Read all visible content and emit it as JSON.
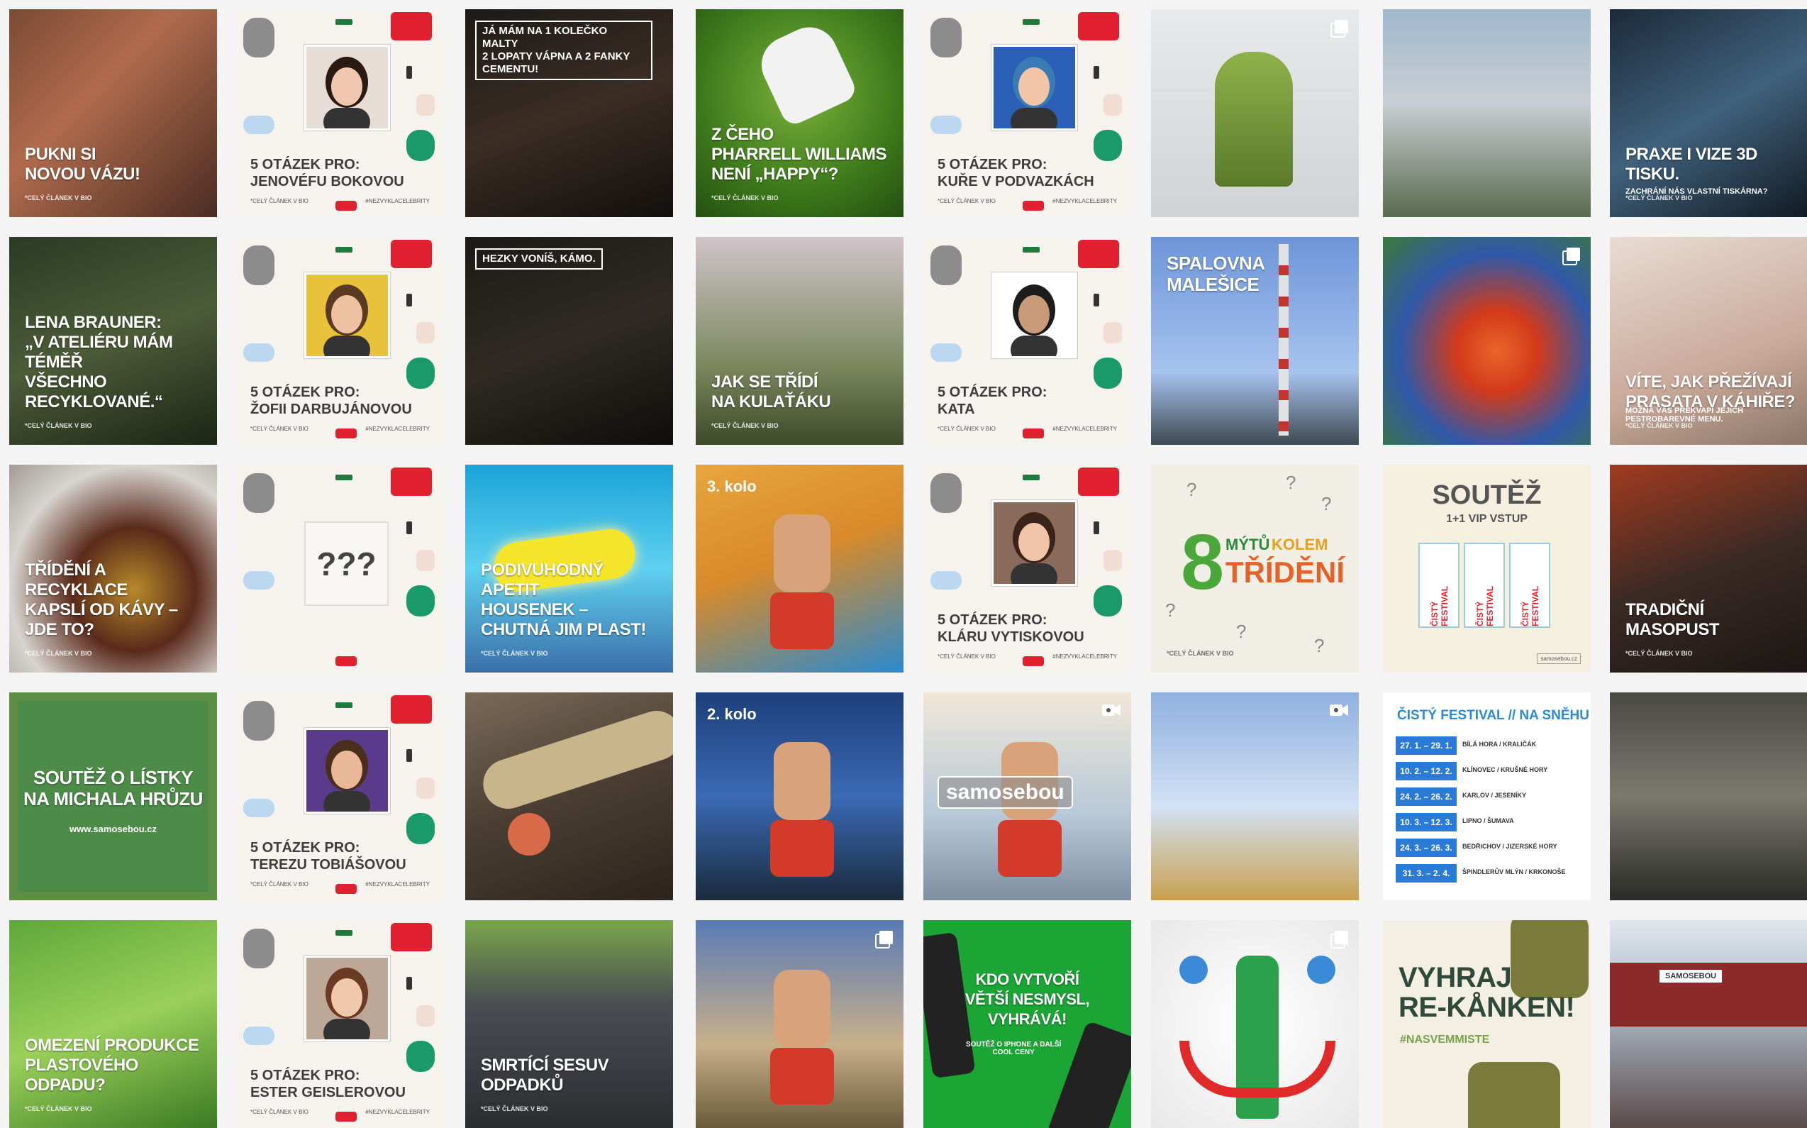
{
  "grid": {
    "tiles": [
      {
        "caption": "Pukni si\nnovou vázu!",
        "sub": "*celý článek v bio"
      },
      {
        "qtitle": "5 otázek pro:\nJenovéfu Bokovou",
        "qsub": "*celý článek v bio",
        "qtag": "#nezvyklacelebrity"
      },
      {
        "badge": "Já mám na 1 kolečko malty\n2 lopaty vápna a 2 fanky cementu!"
      },
      {
        "caption": "Z čeho\nPharrell Williams\nnení „happy“?",
        "sub": "*celý článek v bio"
      },
      {
        "qtitle": "5 otázek pro:\nKuře v podvazkách",
        "qsub": "*celý článek v bio",
        "qtag": "#nezvyklacelebrity"
      },
      {
        "icon": "gallery-icon"
      },
      {},
      {
        "caption": "Praxe i vize 3D tisku.",
        "subcaption": "Zachrání nás vlastní tiskárna?",
        "sub": "*celý článek v bio"
      },
      {
        "caption": "Lena Brauner:\n„V ateliéru mám téměř\nvšechno recyklované.“",
        "sub": "*celý článek v bio"
      },
      {
        "qtitle": "5 otázek pro:\nŽofii Darbujánovou",
        "qsub": "*celý článek v bio",
        "qtag": "#nezvyklacelebrity"
      },
      {
        "badge": "Hezky voníš, kámo."
      },
      {
        "caption": "Jak se třídí\nna kulaťáku",
        "sub": "*celý článek v bio"
      },
      {
        "qtitle": "5 otázek pro:\nKata",
        "qsub": "*celý článek v bio",
        "qtag": "#nezvyklacelebrity"
      },
      {
        "caption": "Spalovna\nMalešice"
      },
      {
        "icon": "gallery-icon"
      },
      {
        "caption": "Víte, jak přežívají\nprasata v Káhiře?",
        "subcaption": "Možná vás překvapí jejich\npestrobarevné menu.",
        "sub": "*celý článek v bio"
      },
      {
        "caption": "Třídění a recyklace\nkapslí od kávy – jde to?",
        "sub": "*celý článek v bio"
      },
      {
        "mystery": "???"
      },
      {
        "caption": "Podivuhodný apetit\nhousenek – chutná jim plast!",
        "sub": "*celý článek v bio"
      },
      {
        "round": "3. kolo"
      },
      {
        "qtitle": "5 otázek pro:\nKláru Vytiskovou",
        "qsub": "*celý článek v bio",
        "qtag": "#nezvyklacelebrity"
      },
      {
        "big": "8",
        "mid1": "mýtů",
        "mid2": "kolem",
        "mid3": "třídění",
        "sub": "*celý článek v bio"
      },
      {
        "title": "Soutěž",
        "subtitle": "1+1 VIP vstup",
        "ticket": "Čistý festival",
        "site": "samosebou.cz"
      },
      {
        "caption": "Tradiční\nmasopust",
        "sub": "*celý článek v bio"
      },
      {
        "caption": "Soutěž o lístky\nna Michala Hrůzu",
        "site": "www.samosebou.cz"
      },
      {
        "qtitle": "5 otázek pro:\nTerezu Tobiášovou",
        "qsub": "*celý článek v bio",
        "qtag": "#nezvyklacelebrity"
      },
      {},
      {
        "round": "2. kolo"
      },
      {
        "logo": "samosebou",
        "icon": "video-icon"
      },
      {
        "icon": "video-icon"
      },
      {
        "title": "Čistý festival // na sněhu",
        "rows": [
          {
            "date": "27. 1. – 29. 1.",
            "place": "Bílá Hora / Kraličák"
          },
          {
            "date": "10. 2. – 12. 2.",
            "place": "Klínovec / Krušné hory"
          },
          {
            "date": "24. 2. – 26. 2.",
            "place": "Karlov / Jeseníky"
          },
          {
            "date": "10. 3. – 12. 3.",
            "place": "Lipno / Šumava"
          },
          {
            "date": "24. 3. – 26. 3.",
            "place": "Bedřichov / Jizerské hory"
          },
          {
            "date": "31. 3. – 2. 4.",
            "place": "Špindlerův Mlýn / Krkonoše"
          }
        ]
      },
      {},
      {
        "caption": "Omezení produkce\nplastového odpadu?",
        "sub": "*celý článek v bio"
      },
      {
        "qtitle": "5 otázek pro:\nEster Geislerovou",
        "qsub": "*celý článek v bio",
        "qtag": "#nezvyklacelebrity"
      },
      {
        "caption": "Smrtící sesuv\nodpadků",
        "sub": "*celý článek v bio"
      },
      {
        "icon": "gallery-icon"
      },
      {
        "caption": "Kdo vytvoří\nvětší nesmysl,\nvyhrává!",
        "subcaption": "Soutěž o iPhone a další\ncool ceny"
      },
      {
        "icon": "gallery-icon"
      },
      {
        "caption": "Vyhraj\nre-kånken!",
        "tag": "#nasvemmiste"
      },
      {
        "banner": "Samosebou"
      }
    ]
  },
  "colors": {
    "qbg": "#f6f3ee",
    "accent": "#e5202e",
    "green": "#22a35a"
  }
}
